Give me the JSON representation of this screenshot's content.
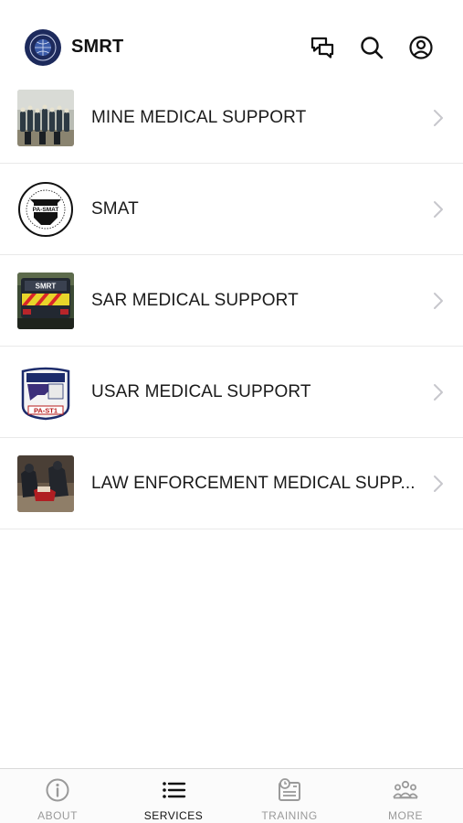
{
  "header": {
    "app_title": "SMRT",
    "icons": [
      "logo-seal",
      "chat-bubbles-icon",
      "search-icon",
      "account-icon"
    ]
  },
  "services": [
    {
      "label": "MINE MEDICAL SUPPORT",
      "thumb": "team-photo"
    },
    {
      "label": "SMAT",
      "thumb": "pa-smat-seal",
      "thumb_text": "PA-SMAT"
    },
    {
      "label": "SAR MEDICAL SUPPORT",
      "thumb": "smrt-vehicle-photo",
      "thumb_text": "SMRT"
    },
    {
      "label": "USAR MEDICAL SUPPORT",
      "thumb": "pa-st1-patch",
      "thumb_text": "PA-ST1"
    },
    {
      "label": "LAW ENFORCEMENT MEDICAL SUPP...",
      "thumb": "tactical-medics-photo"
    }
  ],
  "tabs": [
    {
      "label": "ABOUT",
      "icon": "info-icon",
      "active": false
    },
    {
      "label": "SERVICES",
      "icon": "list-icon",
      "active": true
    },
    {
      "label": "TRAINING",
      "icon": "training-icon",
      "active": false
    },
    {
      "label": "MORE",
      "icon": "group-icon",
      "active": false
    }
  ],
  "colors": {
    "text": "#1a1a1a",
    "inactive_tab": "#9a9a9a",
    "active_tab": "#111111",
    "divider": "#e9e9e9"
  }
}
